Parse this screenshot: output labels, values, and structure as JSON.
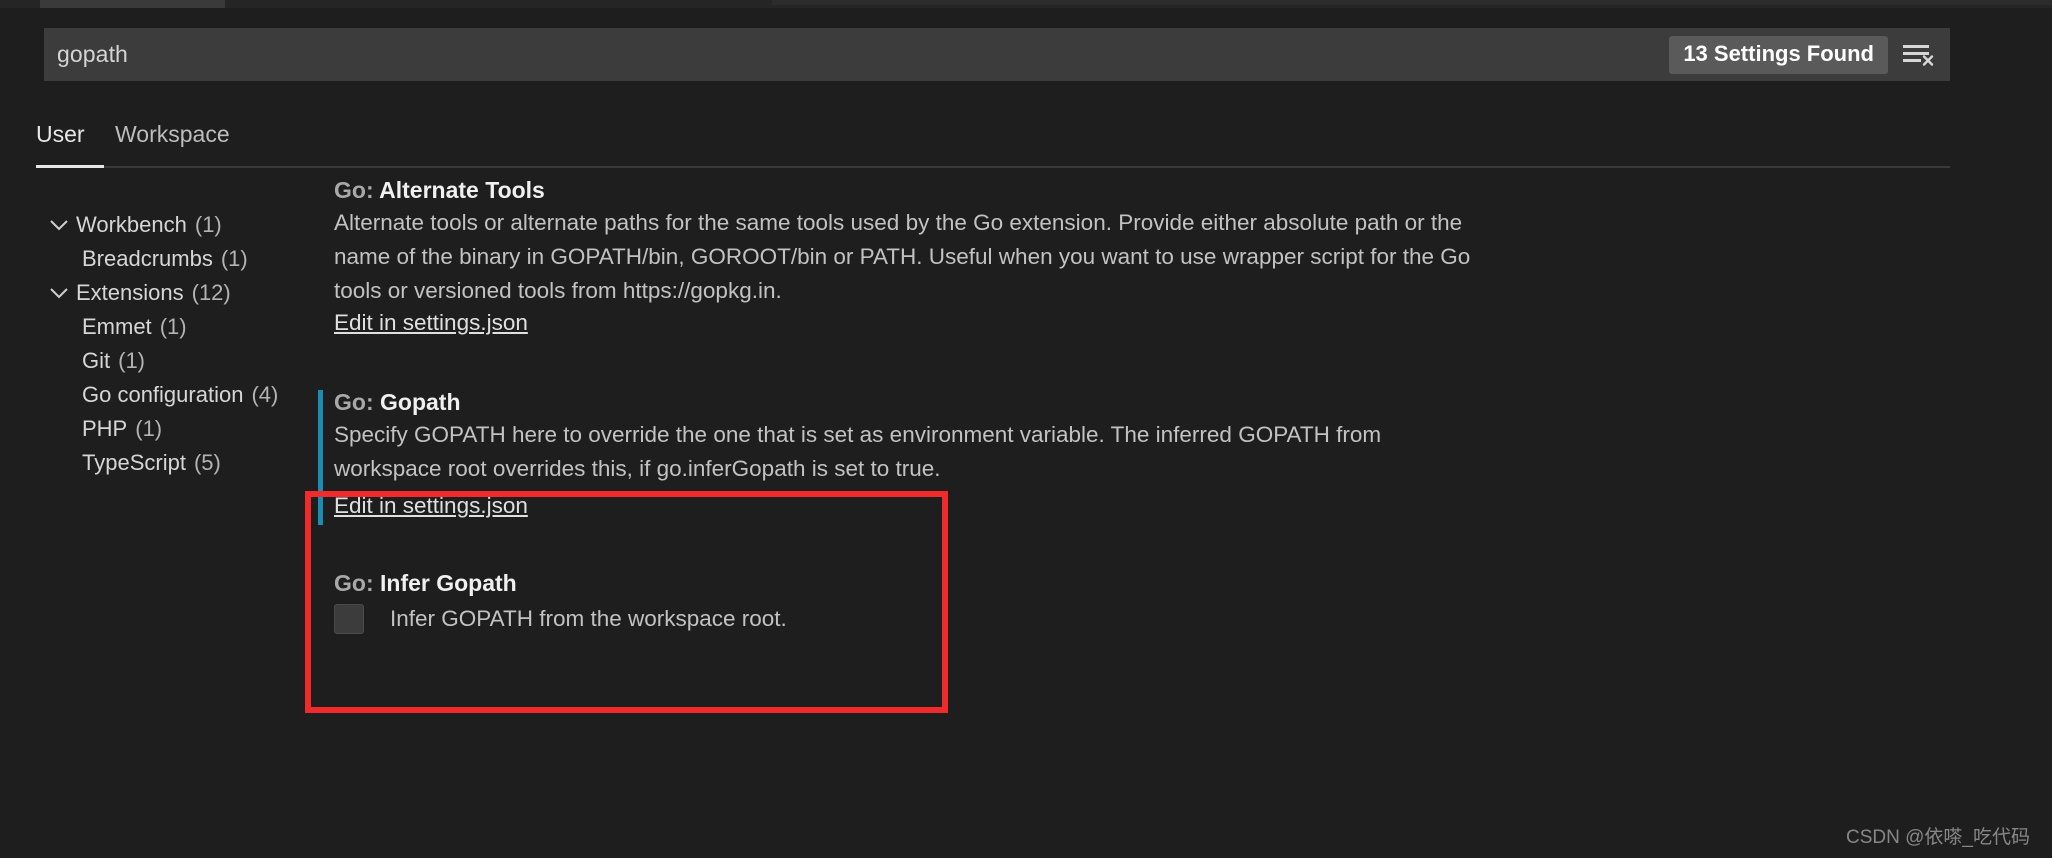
{
  "window": {
    "background": "#1e1e1e",
    "accent_modified": "#1b8cb3",
    "annotation_color": "#f12b2b"
  },
  "search": {
    "value": "gopath",
    "placeholder": "Search settings",
    "results_badge": "13 Settings Found",
    "clear_filter_icon": "clear-filters-icon"
  },
  "tabs": [
    {
      "label": "User",
      "active": true
    },
    {
      "label": "Workspace",
      "active": false
    }
  ],
  "tree": [
    {
      "label": "Workbench",
      "count": "(1)",
      "level": 0,
      "expanded": true
    },
    {
      "label": "Breadcrumbs",
      "count": "(1)",
      "level": 1,
      "expanded": null
    },
    {
      "label": "Extensions",
      "count": "(12)",
      "level": 0,
      "expanded": true
    },
    {
      "label": "Emmet",
      "count": "(1)",
      "level": 1,
      "expanded": null
    },
    {
      "label": "Git",
      "count": "(1)",
      "level": 1,
      "expanded": null
    },
    {
      "label": "Go configuration",
      "count": "(4)",
      "level": 1,
      "expanded": null
    },
    {
      "label": "PHP",
      "count": "(1)",
      "level": 1,
      "expanded": null
    },
    {
      "label": "TypeScript",
      "count": "(5)",
      "level": 1,
      "expanded": null
    }
  ],
  "settings": {
    "alternate_tools": {
      "prefix": "Go: ",
      "name": "Alternate Tools",
      "description": "Alternate tools or alternate paths for the same tools used by the Go extension. Provide either absolute path or the name of the binary in GOPATH/bin, GOROOT/bin or PATH. Useful when you want to use wrapper script for the Go tools or versioned tools from https://gopkg.in.",
      "link": "Edit in settings.json"
    },
    "gopath": {
      "prefix": "Go: ",
      "name": "Gopath",
      "description": "Specify GOPATH here to override the one that is set as environment variable. The inferred GOPATH from workspace root overrides this, if go.inferGopath is set to true.",
      "link": "Edit in settings.json",
      "modified": true
    },
    "infer_gopath": {
      "prefix": "Go: ",
      "name": "Infer Gopath",
      "checkbox_label": "Infer GOPATH from the workspace root.",
      "checked": false
    }
  },
  "watermark": "CSDN @依嗏_吃代码"
}
